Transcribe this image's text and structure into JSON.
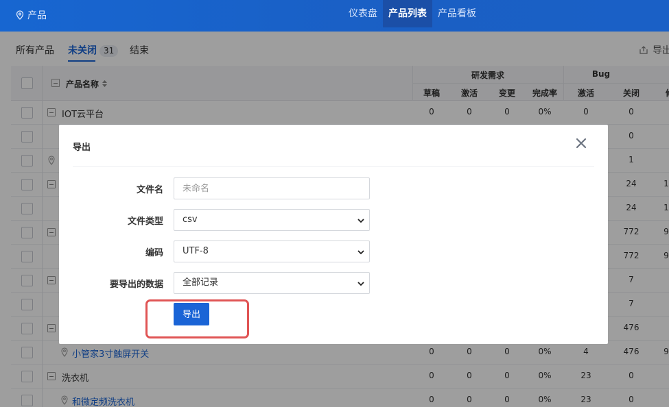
{
  "topbar": {
    "brand": "产品",
    "nav": [
      "仪表盘",
      "产品列表",
      "产品看板"
    ],
    "active_nav": "产品列表"
  },
  "subtabs": {
    "all": "所有产品",
    "unclosed": "未关闭",
    "unclosed_count": "31",
    "closed": "结束",
    "export": "导出"
  },
  "table": {
    "headers": {
      "name": "产品名称",
      "group_dev": "研发需求",
      "group_bug": "Bug",
      "dev_cols": [
        "草稿",
        "激活",
        "变更",
        "完成率"
      ],
      "bug_cols": [
        "激活",
        "关闭"
      ]
    },
    "rows": [
      {
        "name": "IOT云平台",
        "type": "group",
        "values": [
          "0",
          "0",
          "0",
          "0%",
          "0",
          "0"
        ]
      },
      {
        "name": "",
        "type": "item",
        "values": [
          "",
          "",
          "",
          "",
          "",
          "0"
        ]
      },
      {
        "name": "",
        "type": "item-icon",
        "values": [
          "",
          "",
          "",
          "",
          "",
          "1"
        ]
      },
      {
        "name": "",
        "type": "group",
        "values": [
          "",
          "",
          "",
          "",
          "",
          "24"
        ]
      },
      {
        "name": "",
        "type": "item",
        "values": [
          "",
          "",
          "",
          "",
          "",
          "24"
        ]
      },
      {
        "name": "",
        "type": "group",
        "values": [
          "",
          "",
          "",
          "",
          "",
          "772"
        ]
      },
      {
        "name": "",
        "type": "item",
        "values": [
          "",
          "",
          "",
          "",
          "",
          "772"
        ]
      },
      {
        "name": "",
        "type": "group",
        "values": [
          "",
          "",
          "",
          "",
          "",
          "7"
        ]
      },
      {
        "name": "",
        "type": "item",
        "values": [
          "",
          "",
          "",
          "",
          "",
          "7"
        ]
      },
      {
        "name": "",
        "type": "group",
        "values": [
          "",
          "",
          "",
          "",
          "",
          "476"
        ]
      },
      {
        "name": "小管家3寸触屏开关",
        "type": "item-link",
        "values": [
          "0",
          "0",
          "0",
          "0%",
          "4",
          "476"
        ]
      },
      {
        "name": "洗衣机",
        "type": "group",
        "values": [
          "0",
          "0",
          "0",
          "0%",
          "23",
          "0"
        ]
      },
      {
        "name": "和微定频洗衣机",
        "type": "item-link",
        "values": [
          "0",
          "0",
          "0",
          "0%",
          "23",
          "0"
        ]
      }
    ],
    "partial_col": [
      "",
      "",
      "",
      "1",
      "1",
      "9",
      "9",
      "",
      "",
      "",
      "9",
      "",
      ""
    ]
  },
  "modal": {
    "title": "导出",
    "fields": {
      "filename_label": "文件名",
      "filename_placeholder": "未命名",
      "filetype_label": "文件类型",
      "filetype_value": "csv",
      "encoding_label": "编码",
      "encoding_value": "UTF-8",
      "data_label": "要导出的数据",
      "data_value": "全部记录"
    },
    "submit": "导出"
  },
  "colors": {
    "primary": "#1a64d6",
    "topbar": "#1766d1",
    "highlight": "#e05454"
  }
}
